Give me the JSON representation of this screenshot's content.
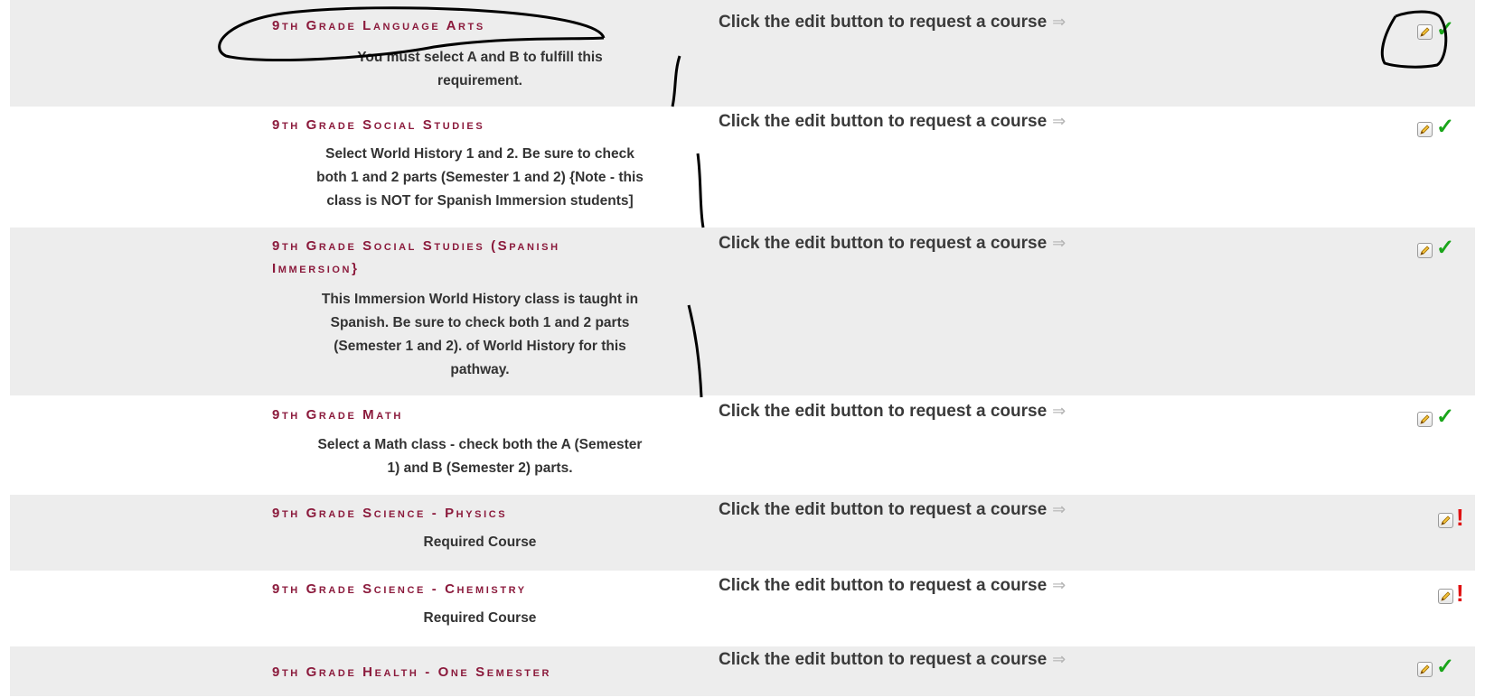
{
  "request_label": "Click the edit button to request a course",
  "arrow_glyph": "⇒",
  "colors": {
    "title": "#8b1a3c",
    "check": "#1aa51a",
    "warn": "#e01010",
    "row_alt": "#ededed"
  },
  "rows": [
    {
      "title": "9th Grade Language Arts",
      "title2": "",
      "desc": [
        "You must select A and B to fulfill this",
        "requirement."
      ],
      "status": "complete",
      "status_icon": "check-icon"
    },
    {
      "title": "9th Grade Social Studies",
      "title2": "",
      "desc": [
        "Select World History 1 and 2. Be sure to check",
        "both 1 and 2 parts (Semester 1 and 2) {Note - this",
        "class is NOT for Spanish Immersion students]"
      ],
      "status": "complete",
      "status_icon": "check-icon"
    },
    {
      "title": "9th Grade Social Studies (Spanish",
      "title2": "Immersion}",
      "desc": [
        "This Immersion World History class is taught in",
        "Spanish. Be sure to check both 1 and 2 parts",
        "(Semester 1 and 2). of World History for this",
        "pathway."
      ],
      "status": "complete",
      "status_icon": "check-icon"
    },
    {
      "title": "9th Grade Math",
      "title2": "",
      "desc": [
        "Select a Math class - check both the A (Semester",
        "1) and B (Semester 2) parts."
      ],
      "status": "complete",
      "status_icon": "check-icon"
    },
    {
      "title": "9th Grade Science - Physics",
      "title2": "",
      "desc": [
        "Required Course"
      ],
      "status": "required",
      "status_icon": "exclamation-icon"
    },
    {
      "title": "9th Grade Science - Chemistry",
      "title2": "",
      "desc": [
        "Required Course"
      ],
      "status": "required",
      "status_icon": "exclamation-icon"
    },
    {
      "title": "9th Grade Health - One Semester",
      "title2": "",
      "desc": [],
      "status": "complete",
      "status_icon": "check-icon"
    }
  ]
}
